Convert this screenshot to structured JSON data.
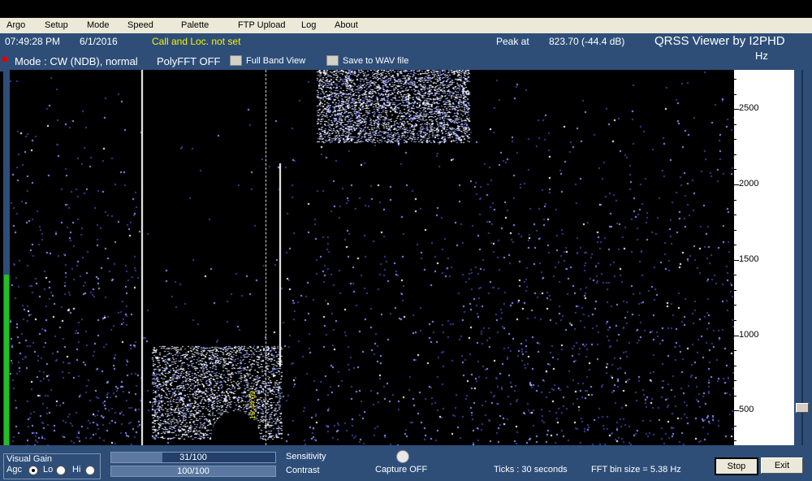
{
  "menu": {
    "items": [
      "Argo",
      "Setup",
      "Mode",
      "Speed",
      "Palette",
      "FTP Upload",
      "Log",
      "About"
    ]
  },
  "status": {
    "time": "07:49:28 PM",
    "date": "6/1/2016",
    "call_loc": "Call and Loc. not set",
    "peak_label": "Peak at",
    "peak_value": "823.70 (-44.4 dB)",
    "app_title": "QRSS Viewer by I2PHD",
    "hz_unit": "Hz"
  },
  "controls": {
    "mode": "Mode : CW (NDB), normal",
    "polyfft": "PolyFFT OFF",
    "full_band_view": "Full Band View",
    "save_wav": "Save to WAV file"
  },
  "scale": {
    "labels": [
      "2500",
      "2000",
      "1500",
      "1000",
      "500"
    ],
    "values": [
      2500,
      2000,
      1500,
      1000,
      500
    ],
    "range": [
      270,
      2760
    ]
  },
  "waterfall": {
    "marker_text": "19:44:09"
  },
  "bottom": {
    "visual_gain": "Visual Gain",
    "agc": "Agc",
    "lo": "Lo",
    "hi": "Hi",
    "sensitivity_text": "31/100",
    "sensitivity_value": 31,
    "sensitivity_label": "Sensitivity",
    "contrast_text": "100/100",
    "contrast_value": 100,
    "contrast_label": "Contrast",
    "capture": "Capture OFF",
    "ticks": "Ticks   : 30 seconds",
    "fft_bin": "FFT bin size = 5.38 Hz",
    "stop": "Stop",
    "exit": "Exit"
  },
  "colors": {
    "panel": "#2e4e78",
    "signal": "#9aa8ff",
    "status_yellow": "#f5f500"
  }
}
